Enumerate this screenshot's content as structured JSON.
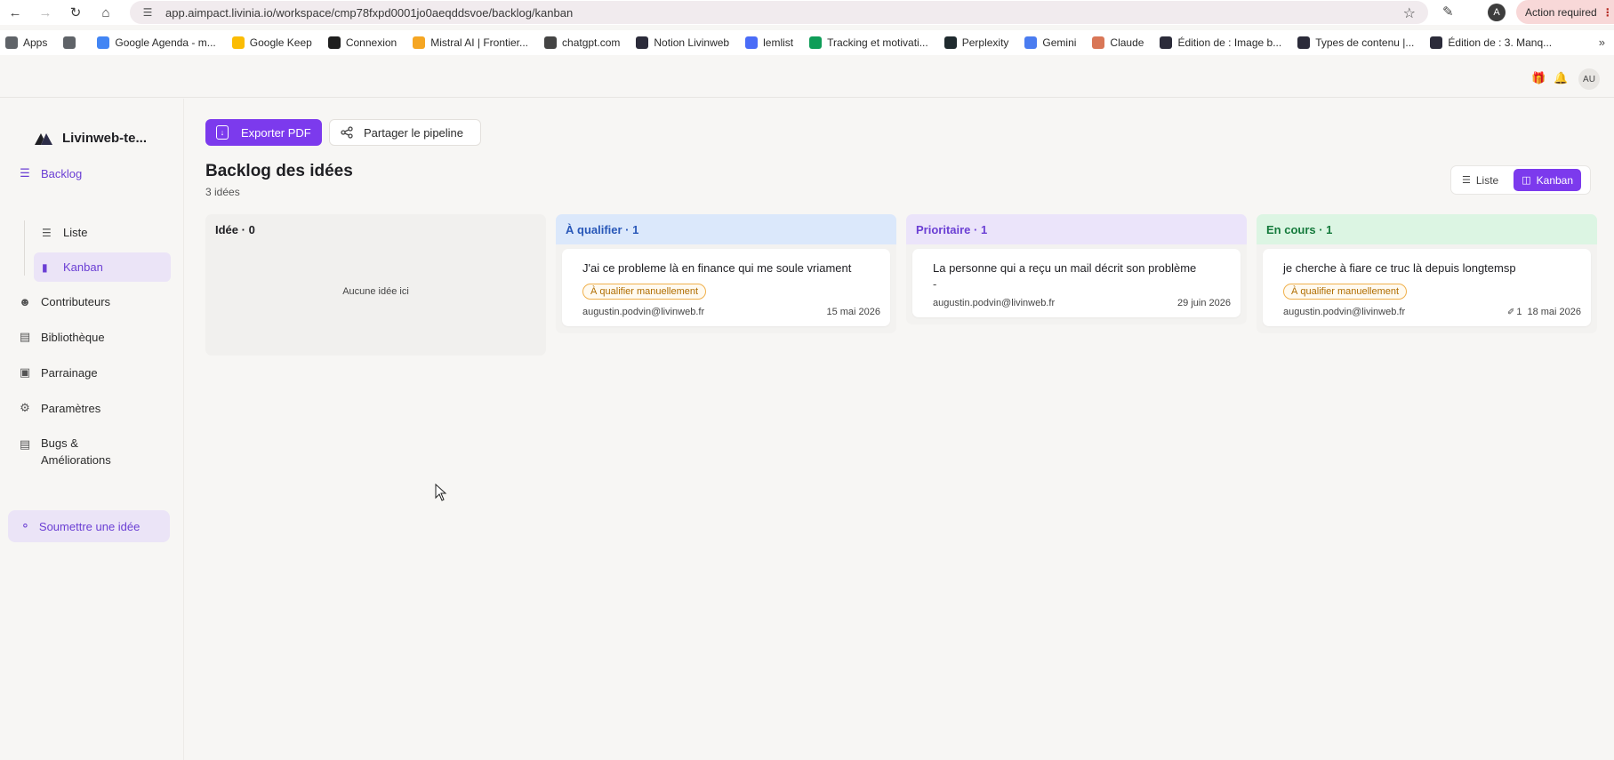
{
  "browser": {
    "url": "app.aimpact.livinia.io/workspace/cmp78fxpd0001jo0aeqddsvoe/backlog/kanban",
    "profile_initial": "A",
    "action_required": "Action required",
    "bookmarks": [
      {
        "label": "Apps",
        "icon": "apps-grid-icon",
        "color": "#5f6368"
      },
      {
        "label": "",
        "icon": "grid-icon",
        "color": "#5f6368"
      },
      {
        "label": "Google Agenda - m...",
        "icon": "calendar-icon",
        "color": "#4285f4"
      },
      {
        "label": "Google Keep",
        "icon": "bulb-icon",
        "color": "#fbbc04"
      },
      {
        "label": "Connexion",
        "icon": "p-icon",
        "color": "#1f1f1f"
      },
      {
        "label": "Mistral AI | Frontier...",
        "icon": "mistral-icon",
        "color": "#f5a623"
      },
      {
        "label": "chatgpt.com",
        "icon": "openai-icon",
        "color": "#444444"
      },
      {
        "label": "Notion Livinweb",
        "icon": "notion-icon",
        "color": "#2b2b3a"
      },
      {
        "label": "lemlist",
        "icon": "lemlist-icon",
        "color": "#4a6cf7"
      },
      {
        "label": "Tracking et motivati...",
        "icon": "sheets-icon",
        "color": "#0f9d58"
      },
      {
        "label": "Perplexity",
        "icon": "perplexity-icon",
        "color": "#1f2a2e"
      },
      {
        "label": "Gemini",
        "icon": "gemini-icon",
        "color": "#4a7cf0"
      },
      {
        "label": "Claude",
        "icon": "claude-icon",
        "color": "#d97757"
      },
      {
        "label": "Édition de : Image b...",
        "icon": "site-icon",
        "color": "#2b2b3a"
      },
      {
        "label": "Types de contenu |...",
        "icon": "site-icon",
        "color": "#2b2b3a"
      },
      {
        "label": "Édition de : 3. Manq...",
        "icon": "site-icon",
        "color": "#2b2b3a"
      }
    ]
  },
  "header": {
    "avatar": "AU"
  },
  "sidebar": {
    "brand": "Livinweb-te...",
    "backlog": "Backlog",
    "liste": "Liste",
    "kanban": "Kanban",
    "contributeurs": "Contributeurs",
    "bibliotheque": "Bibliothèque",
    "parrainage": "Parrainage",
    "parametres": "Paramètres",
    "bugs_line1": "Bugs &",
    "bugs_line2": "Améliorations",
    "submit": "Soumettre une idée"
  },
  "toolbar": {
    "export": "Exporter PDF",
    "share": "Partager le pipeline"
  },
  "page": {
    "title": "Backlog des idées",
    "count": "3 idées"
  },
  "view_toggle": {
    "liste": "Liste",
    "kanban": "Kanban"
  },
  "columns": [
    {
      "title": "Idée · 0",
      "head_color": "#f1f0ee",
      "body_color": "#f1f0ee",
      "text_color": "#1f1f23",
      "empty": "Aucune idée ici",
      "cards": []
    },
    {
      "title": "À qualifier · 1",
      "head_color": "#dbe8fb",
      "body_color": "#f3f2f0",
      "text_color": "#2857b8",
      "cards": [
        {
          "title": "J'ai ce probleme là en finance qui me soule vriament",
          "tag": "À qualifier manuellement",
          "author": "augustin.podvin@livinweb.fr",
          "date": "15 mai 2026",
          "attachments": ""
        }
      ]
    },
    {
      "title": "Prioritaire · 1",
      "head_color": "#ebe4fa",
      "body_color": "#f3f2f0",
      "text_color": "#6b3fd4",
      "cards": [
        {
          "title": "La personne qui a reçu un mail décrit son problème",
          "extra": "-",
          "author": "augustin.podvin@livinweb.fr",
          "date": "29 juin 2026",
          "attachments": ""
        }
      ]
    },
    {
      "title": "En cours · 1",
      "head_color": "#dcf5e3",
      "body_color": "#f3f2f0",
      "text_color": "#157a3c",
      "cards": [
        {
          "title": "je cherche à fiare ce truc là depuis longtemsp",
          "tag": "À qualifier manuellement",
          "author": "augustin.podvin@livinweb.fr",
          "date": "18 mai 2026",
          "attachments": "1"
        }
      ]
    }
  ],
  "colors": {
    "accent": "#7c3aed",
    "accent_soft": "#ebe4f7",
    "tag_border": "#f0b04c",
    "tag_text": "#b06d00"
  }
}
